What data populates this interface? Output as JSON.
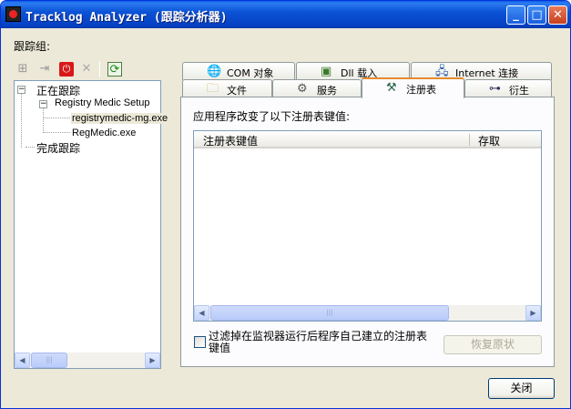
{
  "window": {
    "title": "Tracklog Analyzer (跟踪分析器)",
    "buttons": {
      "minimize": "_",
      "maximize": "□",
      "close": "✕"
    }
  },
  "tracking_group_label": "跟踪组:",
  "toolbar": {
    "icons": [
      "properties-icon",
      "export-icon",
      "stop-icon",
      "delete-icon",
      "refresh-icon"
    ],
    "glyphs": [
      "⊞",
      "⇥",
      "⏻",
      "✕",
      "⟳"
    ]
  },
  "tree": {
    "items": [
      {
        "label": "正在跟踪",
        "expander": "−"
      },
      {
        "label": "Registry Medic Setup",
        "expander": "−"
      },
      {
        "label": "registrymedic-mg.exe"
      },
      {
        "label": "RegMedic.exe"
      },
      {
        "label": "完成跟踪"
      }
    ],
    "scroll": {
      "left": "◀",
      "right": "▶",
      "grip": "|||"
    }
  },
  "tabs": {
    "row1": [
      {
        "label": "COM 对象",
        "icon": "globe-icon",
        "glyph": "🌐"
      },
      {
        "label": "Dll 载入",
        "icon": "dll-icon",
        "glyph": "▣"
      },
      {
        "label": "Internet 连接",
        "icon": "network-icon",
        "glyph": "🖧"
      }
    ],
    "row2": [
      {
        "label": "文件",
        "icon": "folder-icon",
        "glyph": "🗀"
      },
      {
        "label": "服务",
        "icon": "services-icon",
        "glyph": "⚙"
      },
      {
        "label": "注册表",
        "icon": "registry-icon",
        "glyph": "⚒"
      },
      {
        "label": "衍生",
        "icon": "derived-icon",
        "glyph": "⊶"
      }
    ],
    "active": "注册表"
  },
  "registry_tab": {
    "description": "应用程序改变了以下注册表键值:",
    "columns": [
      "注册表键值",
      "存取"
    ],
    "rows": [],
    "filter_label": "过滤掉在监视器运行后程序自己建立的注册表键值",
    "filter_checked": false,
    "restore_button": "恢复原状"
  },
  "close_button": "关闭",
  "colors": {
    "titlebar": "#0b53d6",
    "dialog_bg": "#ece9d8",
    "active_tab_accent": "#e68b2c"
  }
}
